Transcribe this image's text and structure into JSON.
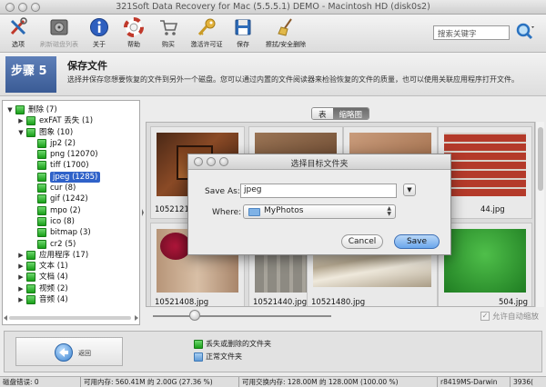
{
  "window": {
    "title": "321Soft Data Recovery for Mac (5.5.5.1) DEMO - Macintosh HD (disk0s2)"
  },
  "toolbar": {
    "items": [
      {
        "label": "选项",
        "icon": "tools-icon"
      },
      {
        "label": "刷新磁盘列表",
        "icon": "disk-refresh-icon"
      },
      {
        "label": "关于",
        "icon": "info-icon"
      },
      {
        "label": "帮助",
        "icon": "help-lifebuoy-icon"
      },
      {
        "label": "购买",
        "icon": "cart-icon"
      },
      {
        "label": "激活许可证",
        "icon": "key-icon"
      },
      {
        "label": "保存",
        "icon": "floppy-icon"
      },
      {
        "label": "擦拭/安全删除",
        "icon": "broom-icon"
      }
    ],
    "search_placeholder": "搜索关键字"
  },
  "step": {
    "badge": "步骤 5",
    "title": "保存文件",
    "description": "选择并保存您想要恢复的文件到另外一个磁盘。您可以通过内置的文件阅读器来检验恢复的文件的质量，也可以使用关联应用程序打开文件。"
  },
  "tree": [
    {
      "label": "删除 (7)",
      "indent": 0,
      "expanded": true
    },
    {
      "label": "exFAT 丢失 (1)",
      "indent": 1,
      "expanded": false
    },
    {
      "label": "图象 (10)",
      "indent": 1,
      "expanded": true
    },
    {
      "label": "jp2 (2)",
      "indent": 2
    },
    {
      "label": "png (12070)",
      "indent": 2
    },
    {
      "label": "tiff (1700)",
      "indent": 2
    },
    {
      "label": "jpeg (1285)",
      "indent": 2,
      "selected": true
    },
    {
      "label": "cur (8)",
      "indent": 2
    },
    {
      "label": "gif (1242)",
      "indent": 2
    },
    {
      "label": "mpo (2)",
      "indent": 2
    },
    {
      "label": "ico (8)",
      "indent": 2
    },
    {
      "label": "bitmap (3)",
      "indent": 2
    },
    {
      "label": "cr2 (5)",
      "indent": 2
    },
    {
      "label": "应用程序 (17)",
      "indent": 1,
      "expanded": false
    },
    {
      "label": "文本 (1)",
      "indent": 1,
      "expanded": false
    },
    {
      "label": "文档 (4)",
      "indent": 1,
      "expanded": false
    },
    {
      "label": "视频 (2)",
      "indent": 1,
      "expanded": false
    },
    {
      "label": "音频 (4)",
      "indent": 1,
      "expanded": false
    }
  ],
  "view_tabs": {
    "list": "表",
    "thumbs": "缩略图"
  },
  "thumbnails": [
    {
      "name": "10521216",
      "theme": "brick-window"
    },
    {
      "name": "",
      "theme": "leather"
    },
    {
      "name": "",
      "theme": "leather-light"
    },
    {
      "name": "44.jpg",
      "theme": "red-brick"
    },
    {
      "name": "10521408.jpg",
      "theme": "flowers-wood"
    },
    {
      "name": "10521440.jpg",
      "theme": "wood-wall"
    },
    {
      "name": "10521480.jpg",
      "theme": "silk"
    },
    {
      "name": "504.jpg",
      "theme": "grass"
    }
  ],
  "auto_zoom_label": "允许自动缩放",
  "dialog": {
    "title": "选择目标文件夹",
    "save_as_label": "Save As:",
    "save_as_value": "jpeg",
    "where_label": "Where:",
    "where_value": "MyPhotos",
    "cancel": "Cancel",
    "save": "Save"
  },
  "bottom": {
    "back_label": "返回",
    "legend": [
      {
        "label": "丢失或删除的文件夹",
        "color": "#2ea82e"
      },
      {
        "label": "正常文件夹",
        "color": "#6fa8e0"
      }
    ]
  },
  "status": {
    "disk_errors": "磁盘错误: 0",
    "memory": "可用内存: 560.41M 的 2.00G (27.36 %)",
    "swap": "可用交换内存: 128.00M 的 128.00M (100.00 %)",
    "host": "r8419MS-Darwin",
    "extra": "3936("
  }
}
